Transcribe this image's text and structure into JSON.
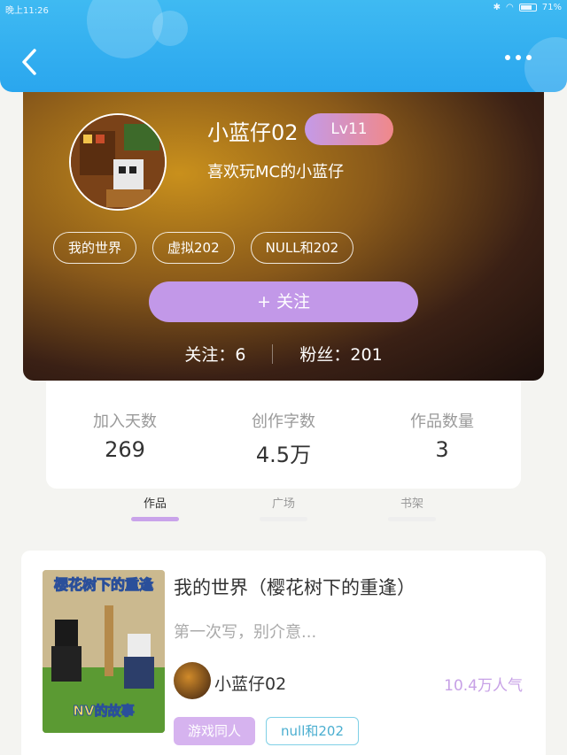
{
  "status_bar": {
    "time": "晚上11:26",
    "battery": "71%"
  },
  "profile": {
    "username": "小蓝仔02",
    "level": "Lv11",
    "bio": "喜欢玩MC的小蓝仔",
    "tags": [
      "我的世界",
      "虚拟202",
      "NULL和202"
    ],
    "follow_label": "+  关注",
    "following": "关注：6",
    "fans": "粉丝：201"
  },
  "stats": [
    {
      "label": "加入天数",
      "value": "269"
    },
    {
      "label": "创作字数",
      "value": "4.5万"
    },
    {
      "label": "作品数量",
      "value": "3"
    }
  ],
  "tabs": [
    {
      "label": "作品",
      "active": true
    },
    {
      "label": "广场",
      "active": false
    },
    {
      "label": "书架",
      "active": false
    }
  ],
  "work": {
    "cover_title": "樱花树下的重逢",
    "cover_subtitle": "NV的故事",
    "title": "我的世界（樱花树下的重逢）",
    "description": "第一次写，别介意...",
    "author": "小蓝仔02",
    "popularity": "10.4万人气",
    "tags": [
      "游戏同人",
      "null和202"
    ]
  },
  "colors": {
    "header": "#2aa6ee",
    "accent": "#c298e8"
  },
  "icons": {
    "back": "chevron-left-icon",
    "more": "more-dots-icon"
  }
}
